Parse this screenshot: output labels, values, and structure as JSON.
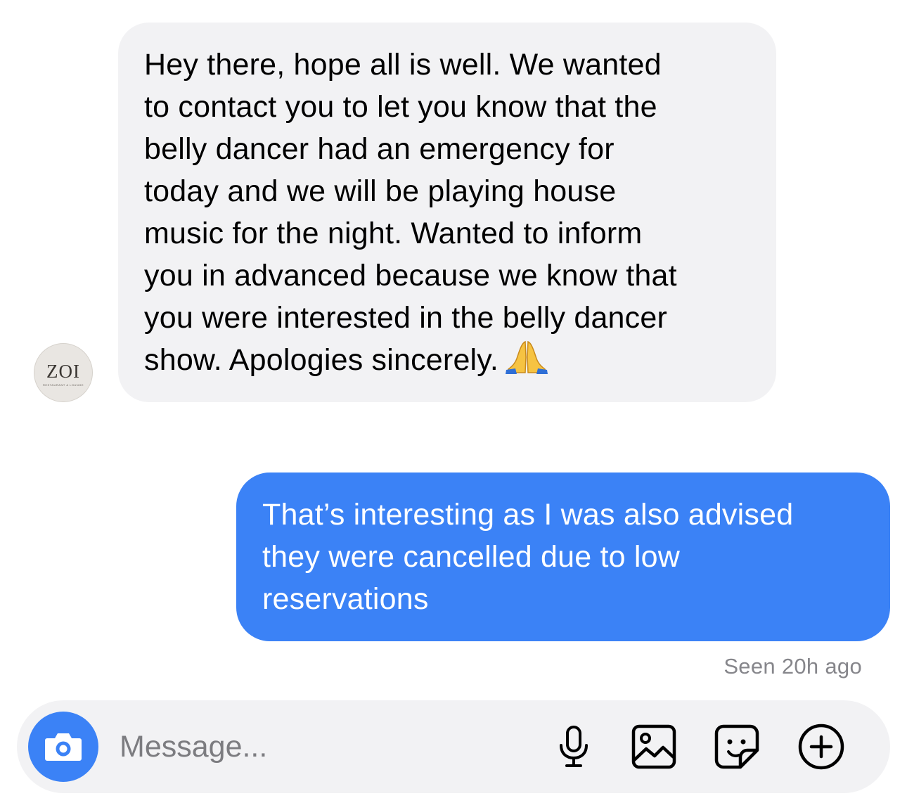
{
  "conversation": {
    "incoming": {
      "avatar": {
        "icon": "zoi-logo-avatar",
        "wordmark": "ZOI",
        "subtext": "RESTAURANT & LOUNGE"
      },
      "lines": [
        "Hey there, hope all is well. We wanted",
        "to contact you to let you know that the",
        "belly dancer had an emergency for",
        "today and we will be playing house",
        "music for the night. Wanted to inform",
        "you in advanced because we know that",
        "you were interested in the belly dancer",
        "show. Apologies sincerely."
      ],
      "emoji": "folded-hands-emoji"
    },
    "outgoing": {
      "lines": [
        "That’s interesting as I was also advised",
        "they were cancelled due to low",
        "reservations"
      ]
    },
    "seen_status": "Seen 20h ago"
  },
  "composer": {
    "placeholder": "Message...",
    "icons": [
      "camera-icon",
      "microphone-icon",
      "gallery-icon",
      "sticker-icon",
      "plus-icon"
    ]
  },
  "colors": {
    "outgoing_bubble": "#3b82f6",
    "incoming_bubble": "#f2f2f4",
    "secondary_text": "#86868b"
  }
}
